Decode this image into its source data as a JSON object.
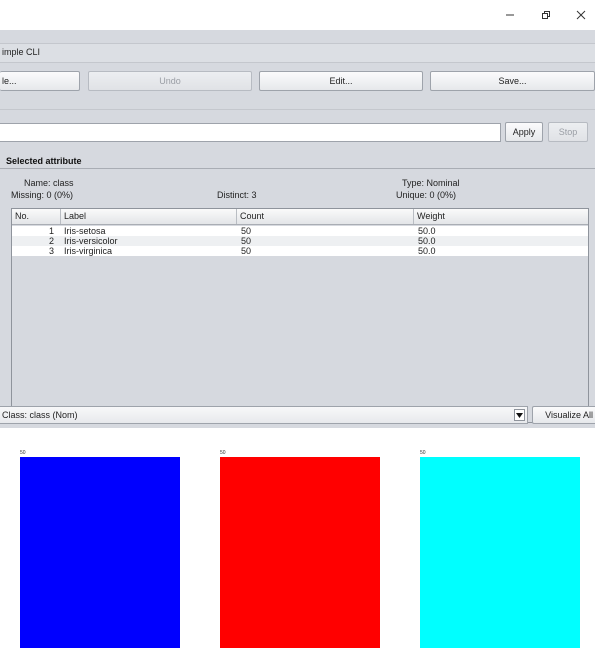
{
  "window": {
    "buttons": [
      "minimize",
      "restore",
      "close"
    ]
  },
  "menubar": {
    "label": "imple CLI"
  },
  "toolbar": {
    "open_label": "le...",
    "undo_label": "Undo",
    "edit_label": "Edit...",
    "save_label": "Save..."
  },
  "filter": {
    "apply_label": "Apply",
    "stop_label": "Stop"
  },
  "selected_attribute": {
    "title": "Selected attribute",
    "name": "Name: class",
    "missing": "Missing: 0 (0%)",
    "distinct": "Distinct: 3",
    "type": "Type: Nominal",
    "unique": "Unique: 0 (0%)"
  },
  "table": {
    "headers": [
      "No.",
      "Label",
      "Count",
      "Weight"
    ],
    "rows": [
      {
        "no": "1",
        "label": "Iris-setosa",
        "count": "50",
        "weight": "50.0"
      },
      {
        "no": "2",
        "label": "Iris-versicolor",
        "count": "50",
        "weight": "50.0"
      },
      {
        "no": "3",
        "label": "Iris-virginica",
        "count": "50",
        "weight": "50.0"
      }
    ]
  },
  "class_selector": {
    "value": "Class: class (Nom)",
    "visualize_label": "Visualize All"
  },
  "chart_data": {
    "type": "bar",
    "categories": [
      "Iris-setosa",
      "Iris-versicolor",
      "Iris-virginica"
    ],
    "values": [
      50,
      50,
      50
    ],
    "colors": [
      "#0000ff",
      "#ff0000",
      "#00ffff"
    ],
    "data_labels": [
      "50",
      "50",
      "50"
    ]
  }
}
